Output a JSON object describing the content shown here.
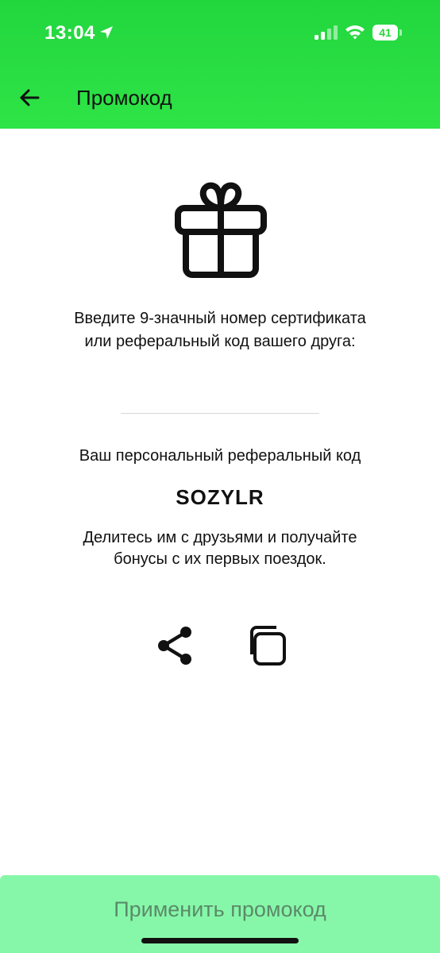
{
  "status_bar": {
    "time": "13:04",
    "battery": "41"
  },
  "header": {
    "title": "Промокод"
  },
  "instruction": {
    "line1": "Введите 9-значный номер сертификата",
    "line2": "или реферальный код вашего друга:"
  },
  "code_input": {
    "value": "",
    "placeholder": ""
  },
  "referral": {
    "label": "Ваш персональный реферальный код",
    "code": "SOZYLR",
    "share_line1": "Делитесь им с друзьями и получайте",
    "share_line2": "бонусы с их первых поездок."
  },
  "apply_button": {
    "label": "Применить промокод"
  },
  "icons": {
    "back": "arrow-left-icon",
    "gift": "gift-icon",
    "share": "share-icon",
    "copy": "copy-icon",
    "location": "location-arrow-icon",
    "signal": "cellular-signal-icon",
    "wifi": "wifi-icon"
  },
  "colors": {
    "header_green": "#2ee446",
    "apply_button_bg": "#86f7a9",
    "apply_button_text": "#5b8a69"
  }
}
